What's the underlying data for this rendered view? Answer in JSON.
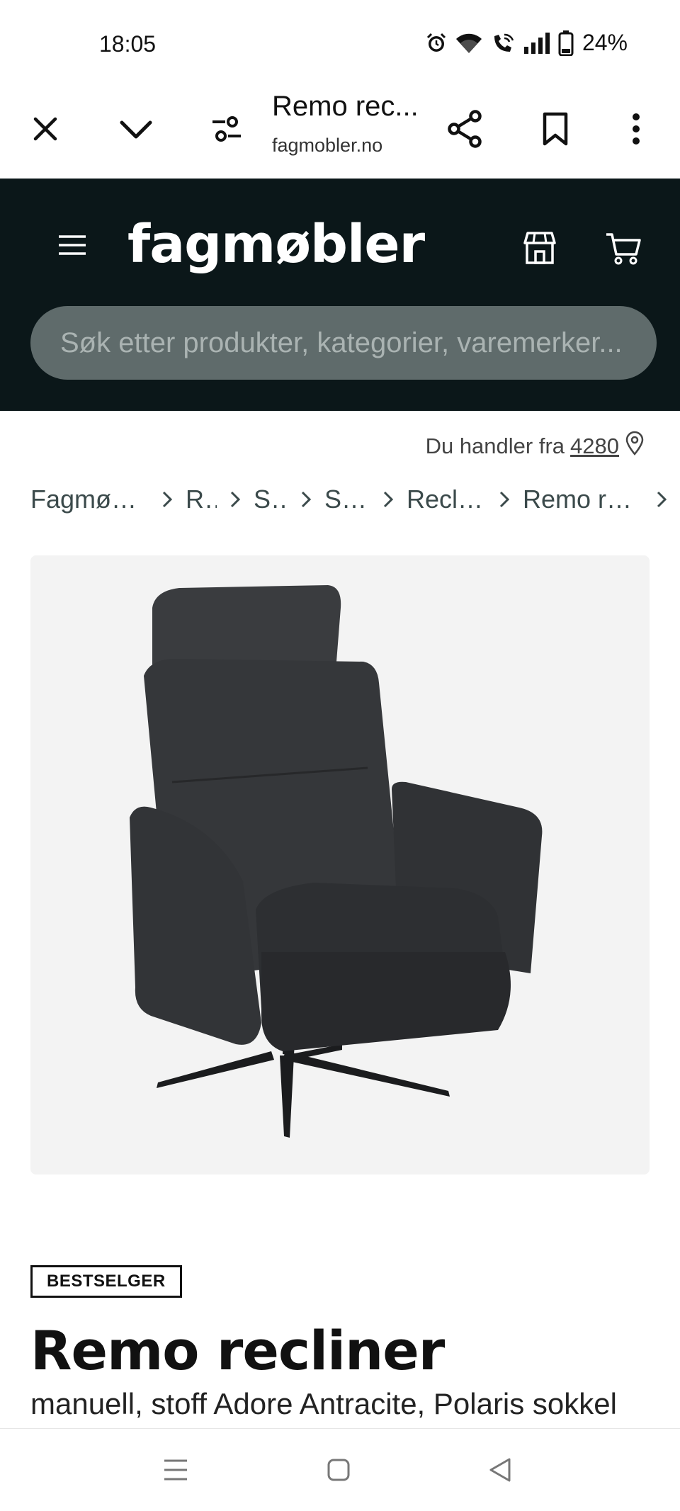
{
  "status_bar": {
    "time": "18:05",
    "battery": "24%",
    "icons": [
      "alarm-icon",
      "wifi-icon",
      "wifi-call-icon",
      "signal-icon",
      "battery-icon"
    ]
  },
  "browser": {
    "tab_title": "Remo rec...",
    "url": "fagmobler.no",
    "icons": [
      "close-icon",
      "chevron-down-icon",
      "tune-icon",
      "share-icon",
      "bookmark-icon",
      "more-vert-icon"
    ]
  },
  "site_header": {
    "logo": "fagmøbler",
    "search_placeholder": "Søk etter produkter, kategorier, varemerker...",
    "background_color": "#0b1719",
    "icons": [
      "menu-icon",
      "store-icon",
      "cart-icon"
    ]
  },
  "location": {
    "prefix": "Du handler fra",
    "zip": "4280"
  },
  "breadcrumb": [
    {
      "label": "Fagmøbler"
    },
    {
      "label": "Rom"
    },
    {
      "label": "Stue"
    },
    {
      "label": "Stoler"
    },
    {
      "label": "Recliner"
    },
    {
      "label": "Remo recliner"
    }
  ],
  "product": {
    "badge": "BESTSELGER",
    "title": "Remo recliner",
    "subtitle": "manuell, stoff Adore Antracite, Polaris sokkel"
  },
  "nav_bar": {
    "icons": [
      "recents-icon",
      "home-icon",
      "back-icon"
    ]
  }
}
